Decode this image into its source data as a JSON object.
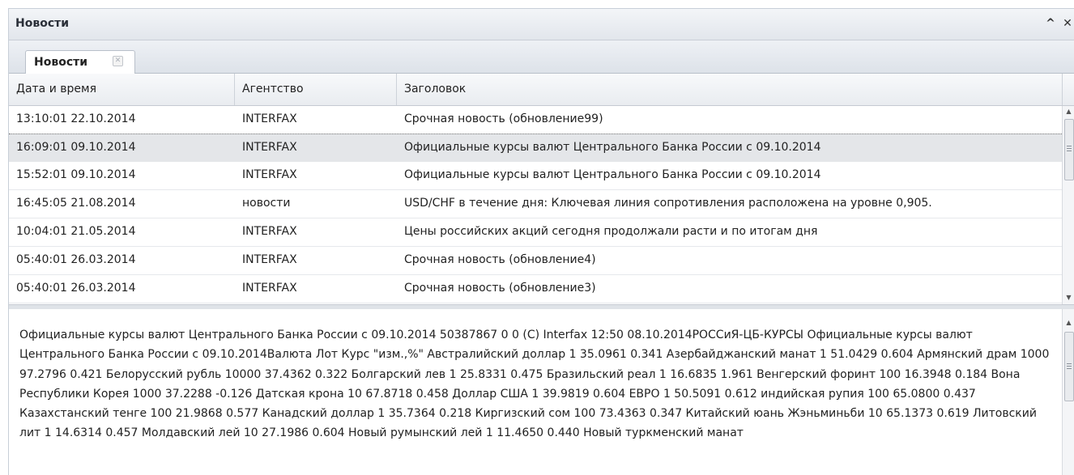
{
  "window": {
    "title": "Новости"
  },
  "tabs": [
    {
      "label": "Новости"
    }
  ],
  "grid": {
    "columns": [
      "Дата и время",
      "Агентство",
      "Заголовок"
    ],
    "selected_index": 1,
    "rows": [
      [
        "13:10:01 22.10.2014",
        "INTERFAX",
        "Срочная новость (обновление99)"
      ],
      [
        "16:09:01 09.10.2014",
        "INTERFAX",
        "Официальные курсы валют Центрального Банка России с 09.10.2014"
      ],
      [
        "15:52:01 09.10.2014",
        "INTERFAX",
        "Официальные курсы валют Центрального Банка России с 09.10.2014"
      ],
      [
        "16:45:05 21.08.2014",
        "новости",
        "USD/CHF в течение дня: Ключевая линия сопротивления расположена на уровне 0,905."
      ],
      [
        "10:04:01 21.05.2014",
        "INTERFAX",
        "Цены российских акций сегодня продолжали расти и по итогам дня"
      ],
      [
        "05:40:01 26.03.2014",
        "INTERFAX",
        "Срочная новость (обновление4)"
      ],
      [
        "05:40:01 26.03.2014",
        "INTERFAX",
        "Срочная новость (обновление3)"
      ]
    ]
  },
  "detail": {
    "text": "Официальные курсы валют Центрального Банка России с 09.10.2014 50387867 0 0 (C) Interfax 12:50 08.10.2014РОССиЯ-ЦБ-КУРСЫ Официальные курсы валют Центрального Банка России с 09.10.2014Валюта Лот Курс \"изм.,%\" Австралийский доллар 1 35.0961 0.341 Азербайджанский манат 1 51.0429 0.604 Армянский драм 1000 97.2796 0.421 Белорусский рубль 10000 37.4362 0.322 Болгарский лев 1 25.8331 0.475 Бразильский реал 1 16.6835 1.961 Венгерский форинт 100 16.3948 0.184 Вона Республики Корея 1000 37.2288 -0.126 Датская крона 10 67.8718 0.458 Доллар США 1 39.9819 0.604 ЕВРО 1 50.5091 0.612 индийская рупия 100 65.0800 0.437 Казахстанский тенге 100 21.9868 0.577 Канадский доллар 1 35.7364 0.218 Киргизский сом 100 73.4363 0.347 Китайский юань Жэньминьби 10 65.1373 0.619 Литовский лит 1 14.6314 0.457 Молдавский лей 10 27.1986 0.604 Новый румынский лей 1 11.4650 0.440 Новый туркменский манат"
  },
  "icons": {
    "collapse": "^",
    "close": "✕",
    "tab_close": "✕"
  }
}
